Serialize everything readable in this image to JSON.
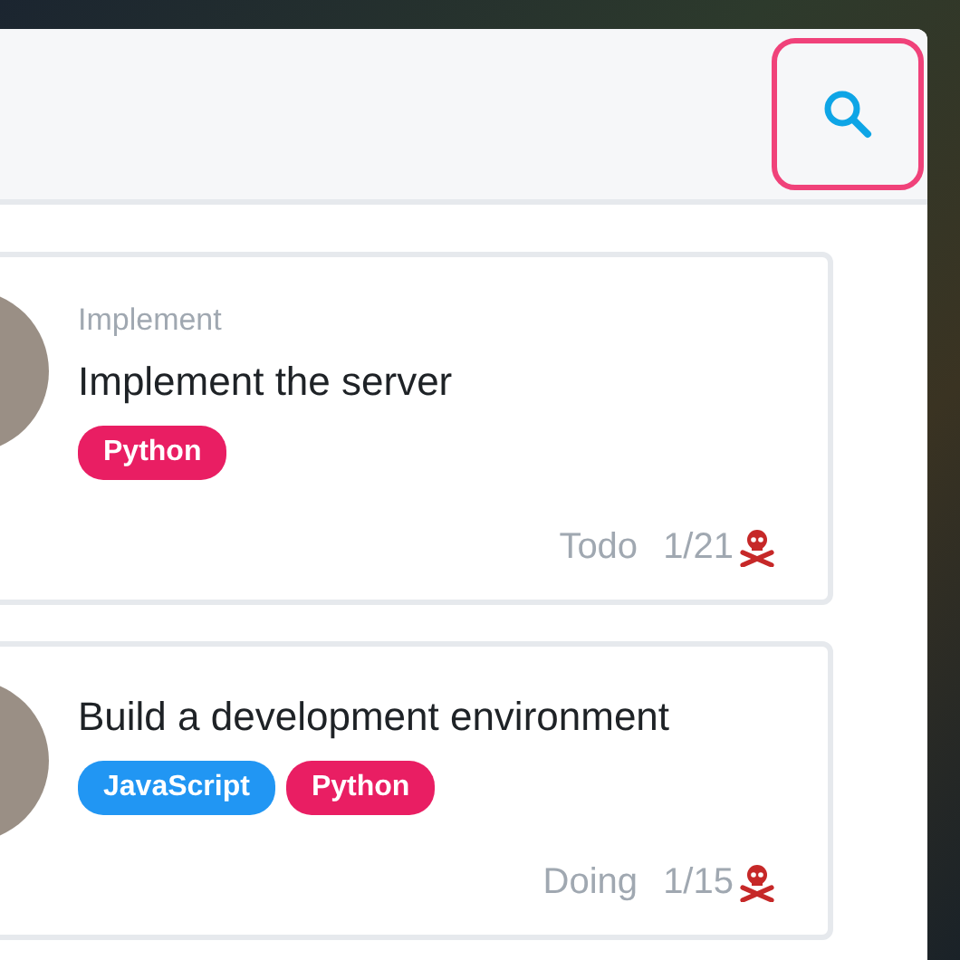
{
  "search_button": {
    "focused": true
  },
  "tasks": [
    {
      "category": "Implement",
      "title": "Implement the server",
      "tags": [
        {
          "label": "Python",
          "color": "#e91e63"
        }
      ],
      "status": "Todo",
      "count": "1/21"
    },
    {
      "title": "Build a development environment",
      "tags": [
        {
          "label": "JavaScript",
          "color": "#2196f3"
        },
        {
          "label": "Python",
          "color": "#e91e63"
        }
      ],
      "status": "Doing",
      "count": "1/15"
    }
  ]
}
